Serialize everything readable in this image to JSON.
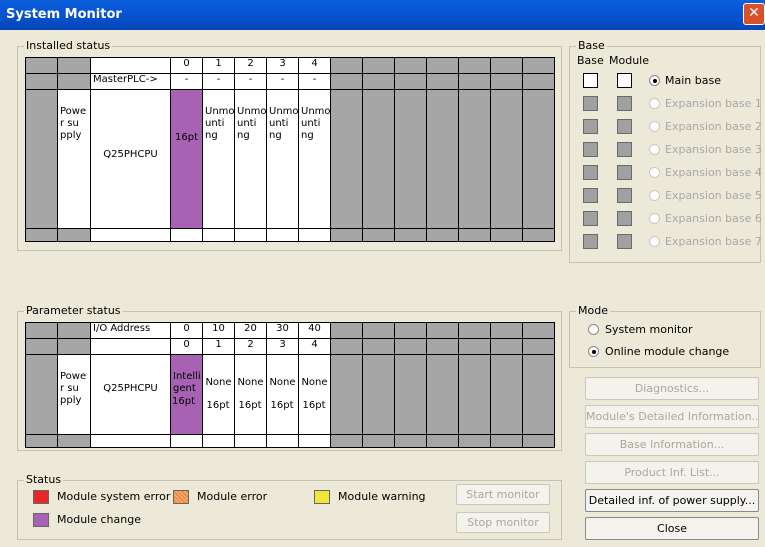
{
  "window": {
    "title": "System Monitor",
    "close_glyph": "✕"
  },
  "installed": {
    "title": "Installed status",
    "slot_numbers": [
      "0",
      "1",
      "2",
      "3",
      "4"
    ],
    "master_label": "MasterPLC->",
    "master_vals": [
      "-",
      "-",
      "-",
      "-",
      "-"
    ],
    "power": "Powe r su pply",
    "cpu": "Q25PHCPU",
    "slot0": "16pt",
    "slots": [
      "Unmo unti ng",
      "Unmo unti ng",
      "Unmo unti ng",
      "Unmo unti ng"
    ]
  },
  "parameter": {
    "title": "Parameter status",
    "io_label": "I/O Address",
    "io_vals": [
      "0",
      "10",
      "20",
      "30",
      "40"
    ],
    "slot_numbers": [
      "0",
      "1",
      "2",
      "3",
      "4"
    ],
    "power": "Powe r su pply",
    "cpu": "Q25PHCPU",
    "slot_types": [
      "Intelli gent",
      "None",
      "None",
      "None",
      "None"
    ],
    "slot_points": [
      "16pt",
      "16pt",
      "16pt",
      "16pt",
      "16pt"
    ]
  },
  "base": {
    "title": "Base",
    "col_base": "Base",
    "col_module": "Module",
    "rows": [
      "Main base",
      "Expansion base 1",
      "Expansion base 2",
      "Expansion base 3",
      "Expansion base 4",
      "Expansion base 5",
      "Expansion base 6",
      "Expansion base 7"
    ]
  },
  "mode": {
    "title": "Mode",
    "options": [
      "System monitor",
      "Online module change"
    ],
    "selected": "Online module change"
  },
  "buttons": {
    "diagnostics": "Diagnostics...",
    "module_detail": "Module's Detailed Information...",
    "base_info": "Base Information...",
    "product_list": "Product Inf. List...",
    "power_detail": "Detailed inf. of power supply...",
    "close": "Close",
    "start_monitor": "Start monitor",
    "stop_monitor": "Stop monitor"
  },
  "status": {
    "title": "Status",
    "items": [
      {
        "label": "Module system error",
        "color": "#e8262a"
      },
      {
        "label": "Module error",
        "color": "#f08c3c"
      },
      {
        "label": "Module warning",
        "color": "#f2e63a"
      },
      {
        "label": "Module change",
        "color": "#a862b4"
      }
    ]
  }
}
